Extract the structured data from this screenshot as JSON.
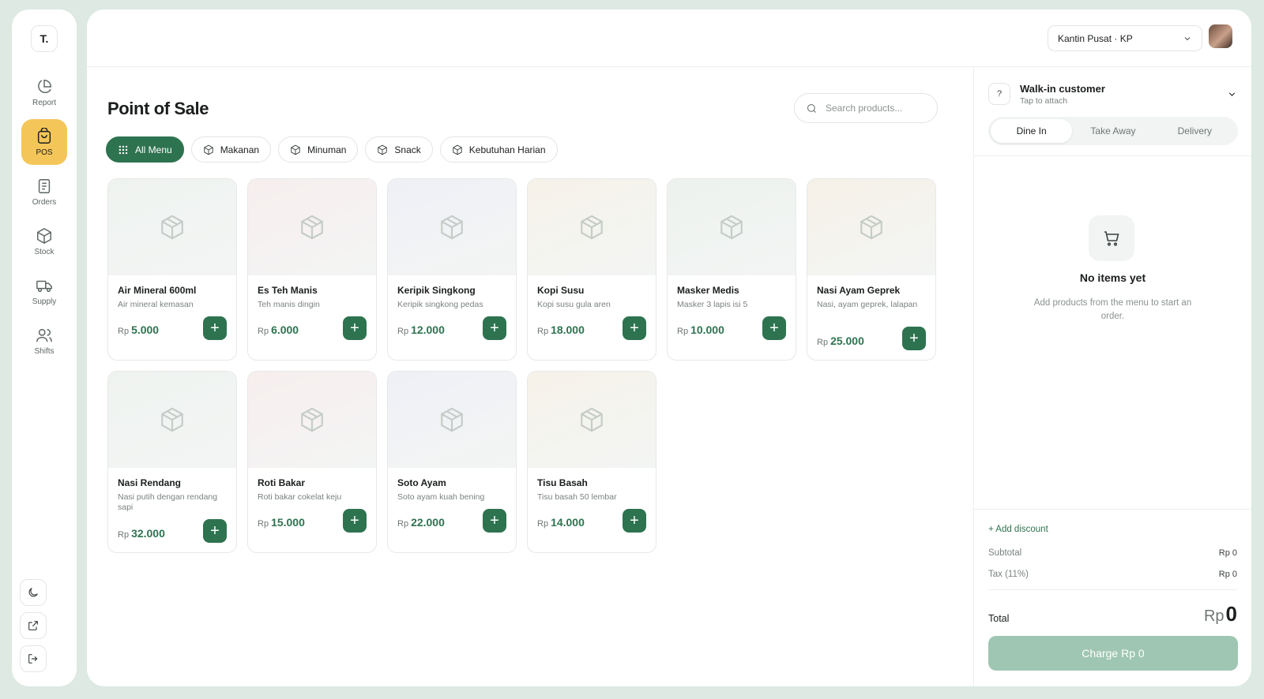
{
  "brand": {
    "logo_text": "T."
  },
  "sidebar": {
    "items": [
      {
        "label": "Report",
        "icon": "pie-chart-icon",
        "active": false
      },
      {
        "label": "POS",
        "icon": "shopping-bag-icon",
        "active": true
      },
      {
        "label": "Orders",
        "icon": "document-icon",
        "active": false
      },
      {
        "label": "Stock",
        "icon": "box-icon",
        "active": false
      },
      {
        "label": "Supply",
        "icon": "truck-icon",
        "active": false
      },
      {
        "label": "Shifts",
        "icon": "users-icon",
        "active": false
      }
    ],
    "bottom": [
      "moon-icon",
      "external-link-icon",
      "logout-icon"
    ]
  },
  "header": {
    "outlet": "Kantin Pusat · KP"
  },
  "page": {
    "title": "Point of Sale",
    "search_placeholder": "Search products..."
  },
  "categories": [
    "All Menu",
    "Makanan",
    "Minuman",
    "Snack",
    "Kebutuhan Harian"
  ],
  "currency": "Rp",
  "products": [
    {
      "name": "Air Mineral 600ml",
      "desc": "Air mineral kemasan",
      "price": "5.000",
      "tint": "#eff3f0"
    },
    {
      "name": "Es Teh Manis",
      "desc": "Teh manis dingin",
      "price": "6.000",
      "tint": "#f7eeee"
    },
    {
      "name": "Keripik Singkong",
      "desc": "Keripik singkong pedas",
      "price": "12.000",
      "tint": "#eef0f6"
    },
    {
      "name": "Kopi Susu",
      "desc": "Kopi susu gula aren",
      "price": "18.000",
      "tint": "#f6f2e9"
    },
    {
      "name": "Masker Medis",
      "desc": "Masker 3 lapis isi 5",
      "price": "10.000",
      "tint": "#edf2ee"
    },
    {
      "name": "Nasi Ayam Geprek",
      "desc": "Nasi, ayam geprek, lalapan",
      "price": "25.000",
      "tint": "#f6f1e8"
    },
    {
      "name": "Nasi Rendang",
      "desc": "Nasi putih dengan rendang sapi",
      "price": "32.000",
      "tint": "#eff3f0"
    },
    {
      "name": "Roti Bakar",
      "desc": "Roti bakar cokelat keju",
      "price": "15.000",
      "tint": "#f7eeee"
    },
    {
      "name": "Soto Ayam",
      "desc": "Soto ayam kuah bening",
      "price": "22.000",
      "tint": "#eef0f6"
    },
    {
      "name": "Tisu Basah",
      "desc": "Tisu basah 50 lembar",
      "price": "14.000",
      "tint": "#f6f2e9"
    }
  ],
  "order": {
    "customer_title": "Walk-in customer",
    "customer_sub": "Tap to attach",
    "customer_icon": "?",
    "types": [
      "Dine In",
      "Take Away",
      "Delivery"
    ],
    "active_type": 0,
    "empty_title": "No items yet",
    "empty_sub": "Add products from the menu to start an order.",
    "add_discount": "+ Add discount",
    "subtotal_label": "Subtotal",
    "subtotal_value": "Rp 0",
    "tax_label": "Tax (11%)",
    "tax_value": "Rp 0",
    "total_label": "Total",
    "total_currency": "Rp",
    "total_value": "0",
    "charge_label": "Charge Rp 0"
  },
  "colors": {
    "primary": "#2e7350",
    "accent": "#f4c65a",
    "charge_disabled": "#9fc6b2",
    "background": "#dde9e2"
  }
}
